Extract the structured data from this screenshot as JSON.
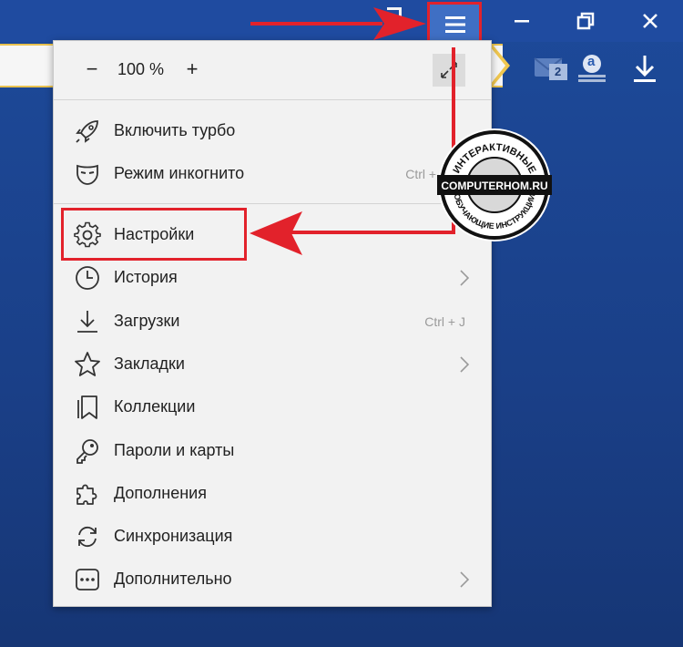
{
  "window": {
    "controls": [
      "minimize",
      "restore",
      "close"
    ]
  },
  "toolbar": {
    "mail_badge": "2",
    "ext_letter": "a"
  },
  "menu": {
    "zoom": {
      "minus": "−",
      "value": "100 %",
      "plus": "+"
    },
    "items": [
      {
        "label": "Включить турбо",
        "icon": "rocket-icon"
      },
      {
        "label": "Режим инкогнито",
        "icon": "mask-icon",
        "shortcut": "Ctrl + Shift"
      },
      {
        "label": "Настройки",
        "icon": "gear-icon"
      },
      {
        "label": "История",
        "icon": "clock-icon",
        "submenu": true
      },
      {
        "label": "Загрузки",
        "icon": "download-icon",
        "shortcut": "Ctrl + J"
      },
      {
        "label": "Закладки",
        "icon": "star-icon",
        "submenu": true
      },
      {
        "label": "Коллекции",
        "icon": "collections-icon"
      },
      {
        "label": "Пароли и карты",
        "icon": "key-icon"
      },
      {
        "label": "Дополнения",
        "icon": "puzzle-icon"
      },
      {
        "label": "Синхронизация",
        "icon": "sync-icon"
      },
      {
        "label": "Дополнительно",
        "icon": "more-icon",
        "submenu": true
      }
    ]
  },
  "watermark": {
    "top_text": "ИНТЕРАКТИВНЫЕ",
    "middle_text": "COMPUTERHOM.RU",
    "bottom_text": "ОБУЧАЮЩИЕ ИНСТРУКЦИИ"
  },
  "colors": {
    "highlight": "#e2222b",
    "background": "#1d4a9a",
    "menu_bg": "#f2f2f2"
  }
}
